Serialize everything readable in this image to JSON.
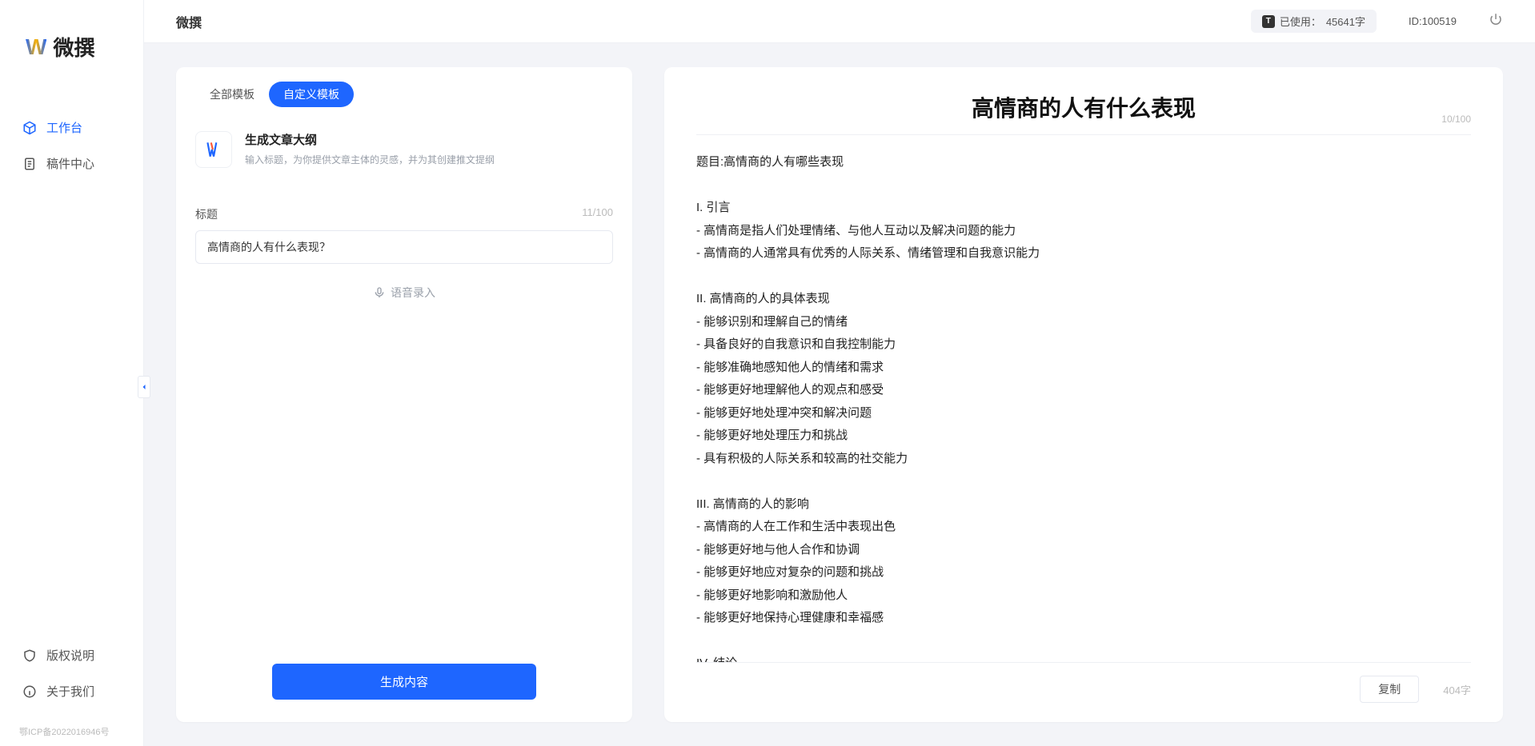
{
  "app": {
    "name": "微撰"
  },
  "logo": {
    "mark": "W",
    "text": "微撰"
  },
  "sidebar": {
    "items": [
      {
        "label": "工作台",
        "icon": "cube-icon",
        "active": true
      },
      {
        "label": "稿件中心",
        "icon": "doc-icon",
        "active": false
      }
    ],
    "bottom": [
      {
        "label": "版权说明",
        "icon": "shield-icon"
      },
      {
        "label": "关于我们",
        "icon": "info-icon"
      }
    ],
    "footer": "鄂ICP备2022016946号"
  },
  "header": {
    "title": "微撰",
    "usage_prefix": "已使用：",
    "usage_value": "45641字",
    "id_prefix": "ID:",
    "id_value": "100519"
  },
  "left": {
    "tabs": [
      {
        "label": "全部模板",
        "active": false
      },
      {
        "label": "自定义模板",
        "active": true
      }
    ],
    "template": {
      "title": "生成文章大纲",
      "desc": "输入标题，为你提供文章主体的灵感，并为其创建推文提纲"
    },
    "field": {
      "label": "标题",
      "count": "11/100",
      "value": "高情商的人有什么表现？"
    },
    "voice_label": "语音录入",
    "generate_label": "生成内容"
  },
  "right": {
    "title": "高情商的人有什么表现",
    "title_count": "10/100",
    "body": "题目:高情商的人有哪些表现\n\nI. 引言\n- 高情商是指人们处理情绪、与他人互动以及解决问题的能力\n- 高情商的人通常具有优秀的人际关系、情绪管理和自我意识能力\n\nII. 高情商的人的具体表现\n- 能够识别和理解自己的情绪\n- 具备良好的自我意识和自我控制能力\n- 能够准确地感知他人的情绪和需求\n- 能够更好地理解他人的观点和感受\n- 能够更好地处理冲突和解决问题\n- 能够更好地处理压力和挑战\n- 具有积极的人际关系和较高的社交能力\n\nIII. 高情商的人的影响\n- 高情商的人在工作和生活中表现出色\n- 能够更好地与他人合作和协调\n- 能够更好地应对复杂的问题和挑战\n- 能够更好地影响和激励他人\n- 能够更好地保持心理健康和幸福感\n\nIV. 结论\n- 高情商的人具有广泛的负面影响和积极影响\n- 高情商的能力是可以通过学习和练习获得的\n- 培养和提高高情商的能力对于个人的职业发展和生活质量至关重要。",
    "copy_label": "复制",
    "char_count": "404字"
  }
}
